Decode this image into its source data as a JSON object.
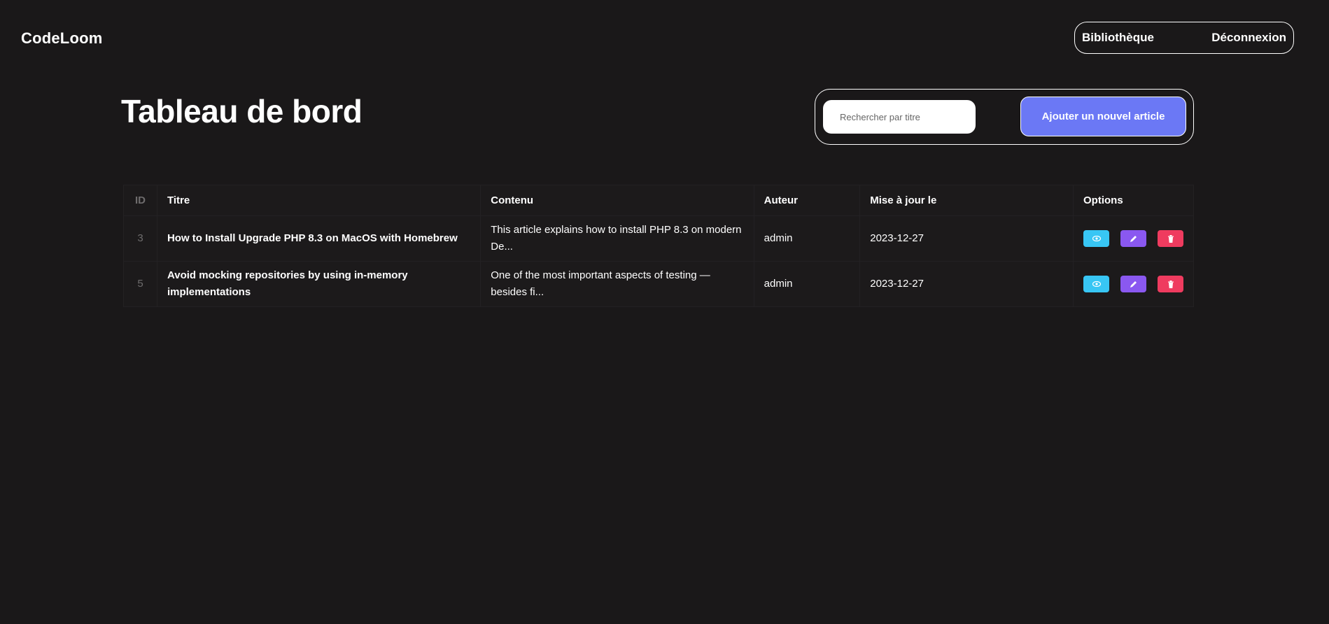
{
  "app": {
    "logo": "CodeLoom"
  },
  "nav": {
    "library": "Bibliothèque",
    "logout": "Déconnexion"
  },
  "page": {
    "title": "Tableau de bord"
  },
  "toolbar": {
    "search_placeholder": "Rechercher par titre",
    "search_value": "",
    "add_label": "Ajouter un nouvel article"
  },
  "table": {
    "headers": {
      "id": "ID",
      "title": "Titre",
      "content": "Contenu",
      "author": "Auteur",
      "updated": "Mise à jour le",
      "options": "Options"
    },
    "rows": [
      {
        "id": "3",
        "title": "How to Install Upgrade PHP 8.3 on MacOS with Homebrew",
        "content": "This article explains how to install PHP 8.3 on modern De...",
        "author": "admin",
        "updated": "2023-12-27"
      },
      {
        "id": "5",
        "title": "Avoid mocking repositories by using in-memory implementations",
        "content": "One of the most important aspects of testing — besides fi...",
        "author": "admin",
        "updated": "2023-12-27"
      }
    ]
  },
  "icons": {
    "view": "eye-icon",
    "edit": "pencil-icon",
    "delete": "trash-icon"
  },
  "colors": {
    "background": "#1a1819",
    "accent": "#6b78f5",
    "view": "#38c6f4",
    "edit": "#8a58f0",
    "delete": "#ef3b5f"
  }
}
